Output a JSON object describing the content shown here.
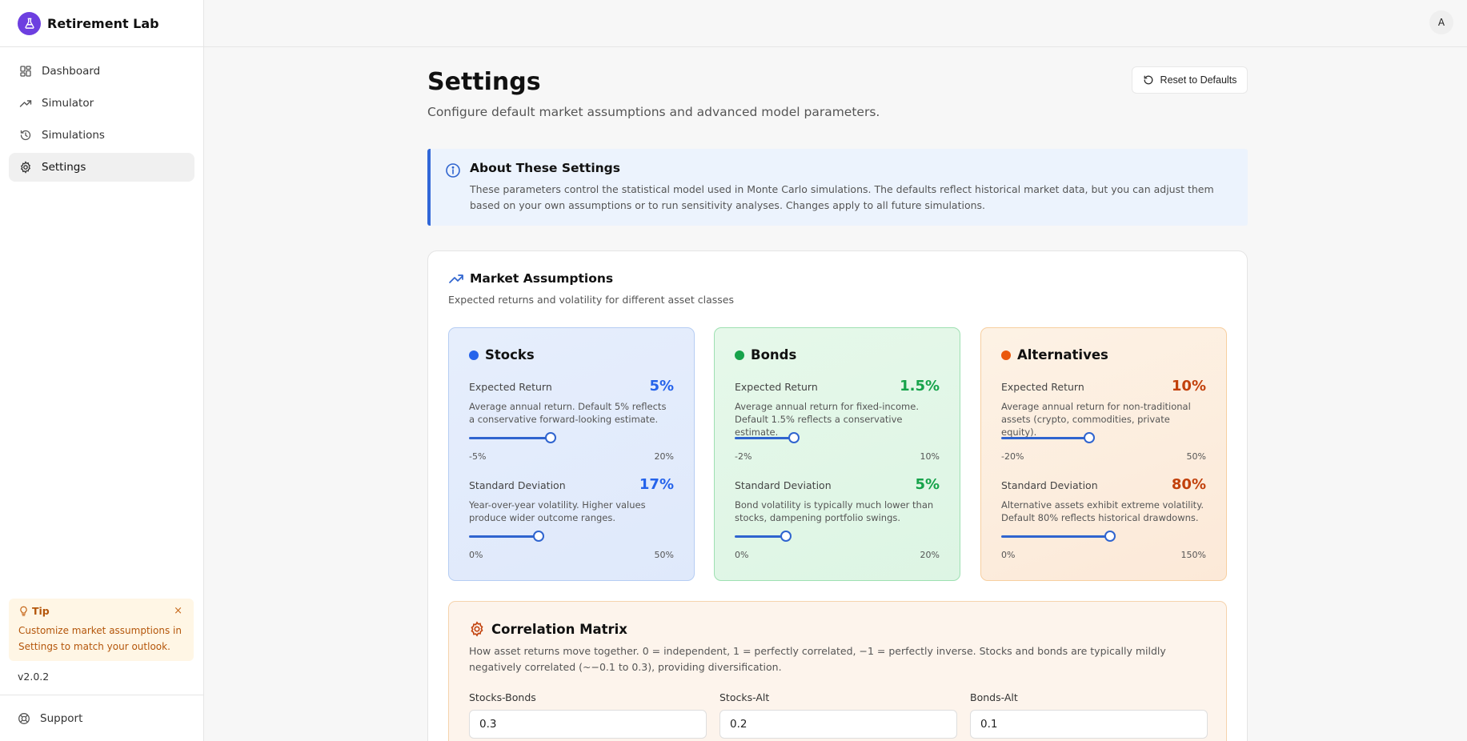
{
  "app": {
    "name": "Retirement Lab",
    "version": "v2.0.2"
  },
  "sidebar": {
    "items": [
      {
        "label": "Dashboard",
        "icon": "grid-icon"
      },
      {
        "label": "Simulator",
        "icon": "trending-up-icon"
      },
      {
        "label": "Simulations",
        "icon": "history-icon"
      },
      {
        "label": "Settings",
        "icon": "gear-icon",
        "active": true
      }
    ],
    "tip": {
      "title": "Tip",
      "text": "Customize market assumptions in Settings to match your outlook.",
      "close": "×"
    },
    "support": "Support"
  },
  "topbar": {
    "avatar": "A"
  },
  "page": {
    "title": "Settings",
    "subtitle": "Configure default market assumptions and advanced model parameters.",
    "reset_label": "Reset to Defaults"
  },
  "info": {
    "title": "About These Settings",
    "text": "These parameters control the statistical model used in Monte Carlo simulations. The defaults reflect historical market data, but you can adjust them based on your own assumptions or to run sensitivity analyses. Changes apply to all future simulations."
  },
  "market": {
    "title": "Market Assumptions",
    "subtitle": "Expected returns and volatility for different asset classes",
    "assets": {
      "stocks": {
        "name": "Stocks",
        "color": "#2563eb",
        "return": {
          "label": "Expected Return",
          "value": "5%",
          "desc": "Average annual return. Default 5% reflects a conservative forward-looking estimate.",
          "min": "-5%",
          "max": "20%",
          "fraction": 0.4
        },
        "stdev": {
          "label": "Standard Deviation",
          "value": "17%",
          "desc": "Year-over-year volatility. Higher values produce wider outcome ranges.",
          "min": "0%",
          "max": "50%",
          "fraction": 0.34
        }
      },
      "bonds": {
        "name": "Bonds",
        "color": "#16a34a",
        "return": {
          "label": "Expected Return",
          "value": "1.5%",
          "desc": "Average annual return for fixed-income. Default 1.5% reflects a conservative estimate.",
          "min": "-2%",
          "max": "10%",
          "fraction": 0.29
        },
        "stdev": {
          "label": "Standard Deviation",
          "value": "5%",
          "desc": "Bond volatility is typically much lower than stocks, dampening portfolio swings.",
          "min": "0%",
          "max": "20%",
          "fraction": 0.25
        }
      },
      "alts": {
        "name": "Alternatives",
        "color": "#c2410c",
        "return": {
          "label": "Expected Return",
          "value": "10%",
          "desc": "Average annual return for non-traditional assets (crypto, commodities, private equity).",
          "min": "-20%",
          "max": "50%",
          "fraction": 0.43
        },
        "stdev": {
          "label": "Standard Deviation",
          "value": "80%",
          "desc": "Alternative assets exhibit extreme volatility. Default 80% reflects historical drawdowns.",
          "min": "0%",
          "max": "150%",
          "fraction": 0.53
        }
      }
    }
  },
  "correlation": {
    "title": "Correlation Matrix",
    "desc": "How asset returns move together. 0 = independent, 1 = perfectly correlated, −1 = perfectly inverse. Stocks and bonds are typically mildly negatively correlated (~−0.1 to 0.3), providing diversification.",
    "fields": [
      {
        "label": "Stocks-Bonds",
        "value": "0.3"
      },
      {
        "label": "Stocks-Alt",
        "value": "0.2"
      },
      {
        "label": "Bonds-Alt",
        "value": "0.1"
      }
    ]
  }
}
